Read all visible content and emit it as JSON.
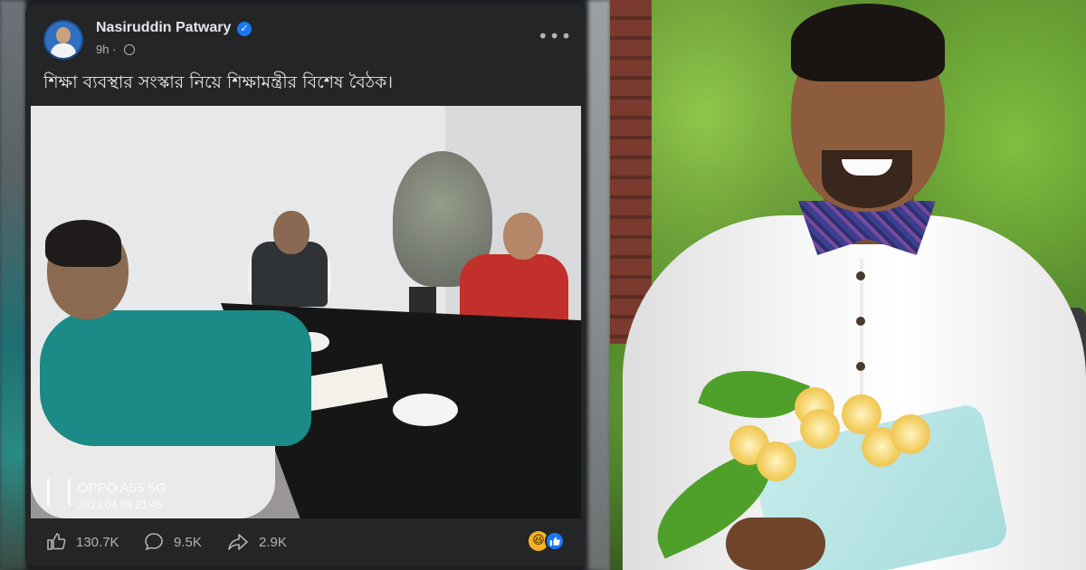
{
  "post": {
    "author_name": "Nasiruddin Patwary",
    "verified_icon": "verified-badge-icon",
    "time": "9h ·",
    "privacy_icon": "globe-icon",
    "more_icon": "more-options-icon",
    "more_glyph": "•••",
    "caption": "শিক্ষা ব্যবস্থার সংস্কার নিয়ে শিক্ষামন্ত্রীর বিশেষ বৈঠক।",
    "photo_watermark": {
      "device": "OPPO A55 5G",
      "datetime": "2023.04.05 21:45"
    }
  },
  "actions": {
    "likes": "130.7K",
    "comments": "9.5K",
    "shares": "2.9K",
    "like_icon": "thumbs-up-icon",
    "comment_icon": "comment-icon",
    "share_icon": "share-icon",
    "reactions": [
      "haha-reaction-icon",
      "like-reaction-icon"
    ]
  },
  "colors": {
    "post_bg": "#242526",
    "text_primary": "#e4e6eb",
    "text_secondary": "#b0b3b8",
    "accent_blue": "#1877f2"
  }
}
